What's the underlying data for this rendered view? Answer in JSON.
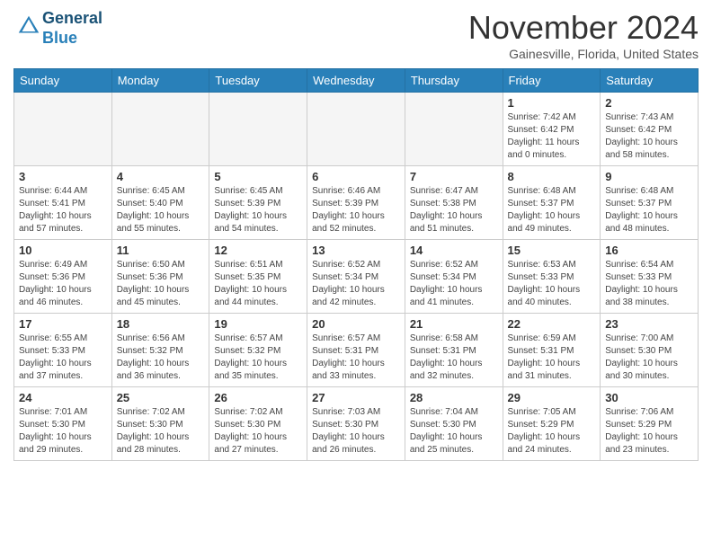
{
  "header": {
    "logo_line1": "General",
    "logo_line2": "Blue",
    "month": "November 2024",
    "location": "Gainesville, Florida, United States"
  },
  "weekdays": [
    "Sunday",
    "Monday",
    "Tuesday",
    "Wednesday",
    "Thursday",
    "Friday",
    "Saturday"
  ],
  "weeks": [
    [
      {
        "day": "",
        "info": ""
      },
      {
        "day": "",
        "info": ""
      },
      {
        "day": "",
        "info": ""
      },
      {
        "day": "",
        "info": ""
      },
      {
        "day": "",
        "info": ""
      },
      {
        "day": "1",
        "info": "Sunrise: 7:42 AM\nSunset: 6:42 PM\nDaylight: 11 hours and 0 minutes."
      },
      {
        "day": "2",
        "info": "Sunrise: 7:43 AM\nSunset: 6:42 PM\nDaylight: 10 hours and 58 minutes."
      }
    ],
    [
      {
        "day": "3",
        "info": "Sunrise: 6:44 AM\nSunset: 5:41 PM\nDaylight: 10 hours and 57 minutes."
      },
      {
        "day": "4",
        "info": "Sunrise: 6:45 AM\nSunset: 5:40 PM\nDaylight: 10 hours and 55 minutes."
      },
      {
        "day": "5",
        "info": "Sunrise: 6:45 AM\nSunset: 5:39 PM\nDaylight: 10 hours and 54 minutes."
      },
      {
        "day": "6",
        "info": "Sunrise: 6:46 AM\nSunset: 5:39 PM\nDaylight: 10 hours and 52 minutes."
      },
      {
        "day": "7",
        "info": "Sunrise: 6:47 AM\nSunset: 5:38 PM\nDaylight: 10 hours and 51 minutes."
      },
      {
        "day": "8",
        "info": "Sunrise: 6:48 AM\nSunset: 5:37 PM\nDaylight: 10 hours and 49 minutes."
      },
      {
        "day": "9",
        "info": "Sunrise: 6:48 AM\nSunset: 5:37 PM\nDaylight: 10 hours and 48 minutes."
      }
    ],
    [
      {
        "day": "10",
        "info": "Sunrise: 6:49 AM\nSunset: 5:36 PM\nDaylight: 10 hours and 46 minutes."
      },
      {
        "day": "11",
        "info": "Sunrise: 6:50 AM\nSunset: 5:36 PM\nDaylight: 10 hours and 45 minutes."
      },
      {
        "day": "12",
        "info": "Sunrise: 6:51 AM\nSunset: 5:35 PM\nDaylight: 10 hours and 44 minutes."
      },
      {
        "day": "13",
        "info": "Sunrise: 6:52 AM\nSunset: 5:34 PM\nDaylight: 10 hours and 42 minutes."
      },
      {
        "day": "14",
        "info": "Sunrise: 6:52 AM\nSunset: 5:34 PM\nDaylight: 10 hours and 41 minutes."
      },
      {
        "day": "15",
        "info": "Sunrise: 6:53 AM\nSunset: 5:33 PM\nDaylight: 10 hours and 40 minutes."
      },
      {
        "day": "16",
        "info": "Sunrise: 6:54 AM\nSunset: 5:33 PM\nDaylight: 10 hours and 38 minutes."
      }
    ],
    [
      {
        "day": "17",
        "info": "Sunrise: 6:55 AM\nSunset: 5:33 PM\nDaylight: 10 hours and 37 minutes."
      },
      {
        "day": "18",
        "info": "Sunrise: 6:56 AM\nSunset: 5:32 PM\nDaylight: 10 hours and 36 minutes."
      },
      {
        "day": "19",
        "info": "Sunrise: 6:57 AM\nSunset: 5:32 PM\nDaylight: 10 hours and 35 minutes."
      },
      {
        "day": "20",
        "info": "Sunrise: 6:57 AM\nSunset: 5:31 PM\nDaylight: 10 hours and 33 minutes."
      },
      {
        "day": "21",
        "info": "Sunrise: 6:58 AM\nSunset: 5:31 PM\nDaylight: 10 hours and 32 minutes."
      },
      {
        "day": "22",
        "info": "Sunrise: 6:59 AM\nSunset: 5:31 PM\nDaylight: 10 hours and 31 minutes."
      },
      {
        "day": "23",
        "info": "Sunrise: 7:00 AM\nSunset: 5:30 PM\nDaylight: 10 hours and 30 minutes."
      }
    ],
    [
      {
        "day": "24",
        "info": "Sunrise: 7:01 AM\nSunset: 5:30 PM\nDaylight: 10 hours and 29 minutes."
      },
      {
        "day": "25",
        "info": "Sunrise: 7:02 AM\nSunset: 5:30 PM\nDaylight: 10 hours and 28 minutes."
      },
      {
        "day": "26",
        "info": "Sunrise: 7:02 AM\nSunset: 5:30 PM\nDaylight: 10 hours and 27 minutes."
      },
      {
        "day": "27",
        "info": "Sunrise: 7:03 AM\nSunset: 5:30 PM\nDaylight: 10 hours and 26 minutes."
      },
      {
        "day": "28",
        "info": "Sunrise: 7:04 AM\nSunset: 5:30 PM\nDaylight: 10 hours and 25 minutes."
      },
      {
        "day": "29",
        "info": "Sunrise: 7:05 AM\nSunset: 5:29 PM\nDaylight: 10 hours and 24 minutes."
      },
      {
        "day": "30",
        "info": "Sunrise: 7:06 AM\nSunset: 5:29 PM\nDaylight: 10 hours and 23 minutes."
      }
    ]
  ]
}
